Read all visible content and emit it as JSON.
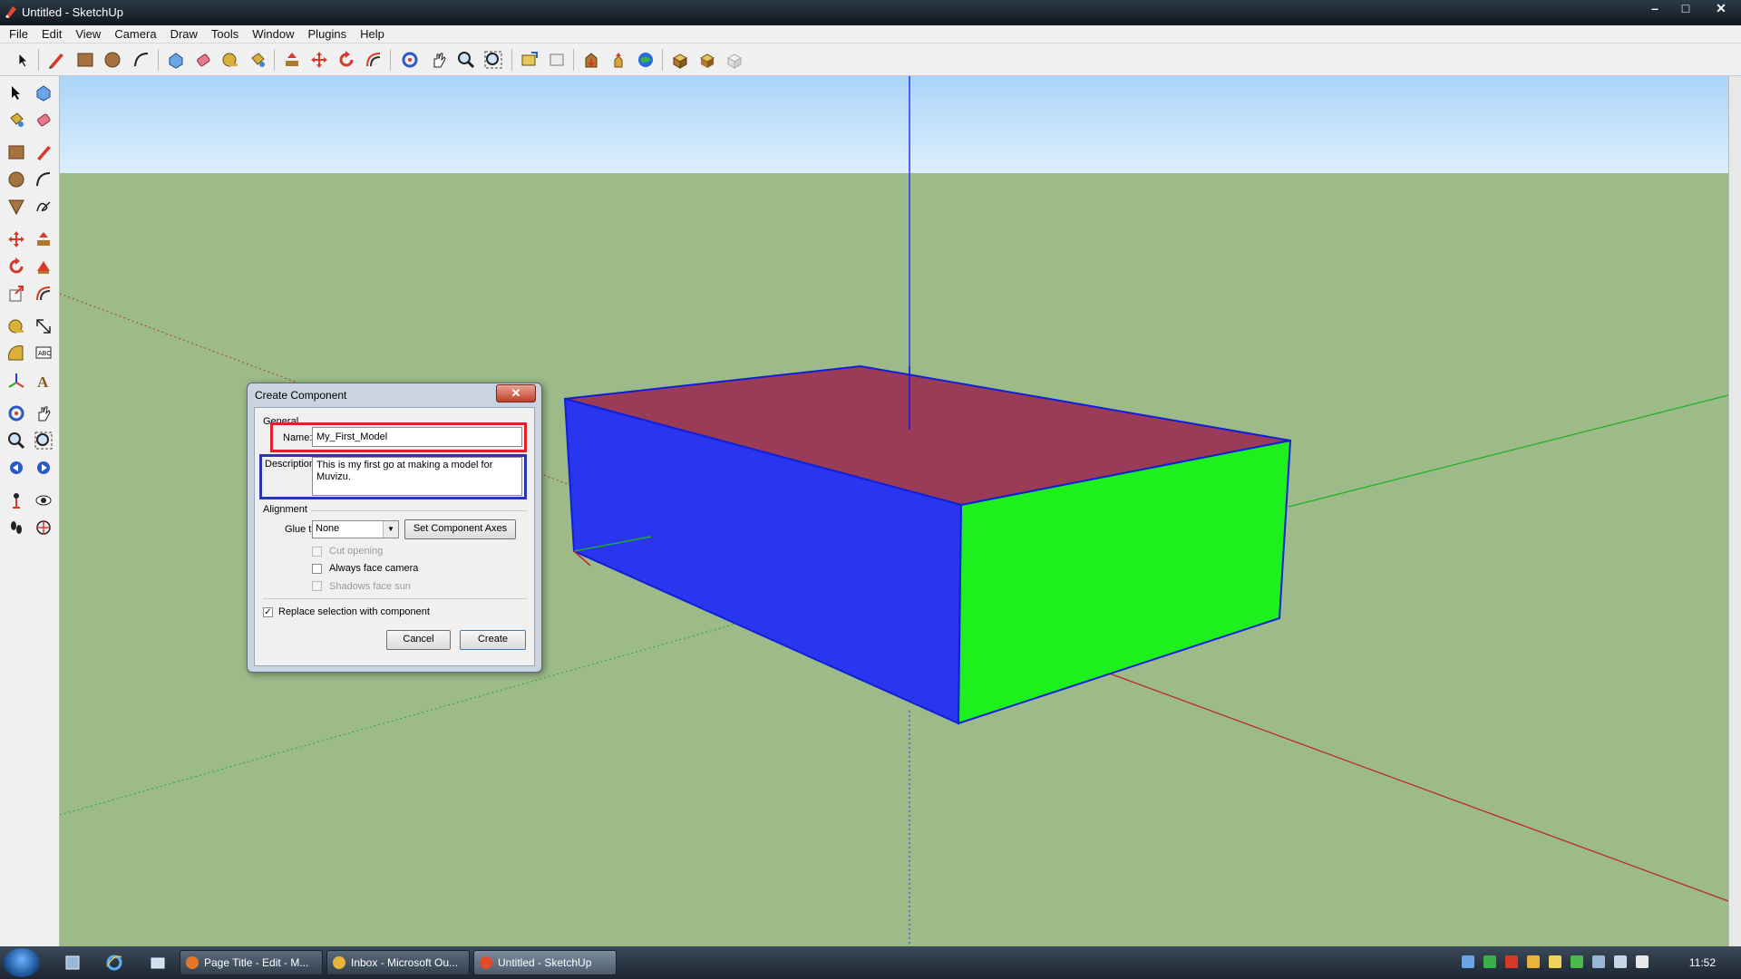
{
  "window": {
    "title": "Untitled - SketchUp"
  },
  "menu": [
    "File",
    "Edit",
    "View",
    "Camera",
    "Draw",
    "Tools",
    "Window",
    "Plugins",
    "Help"
  ],
  "dialog": {
    "title": "Create Component",
    "close_label": "✕",
    "general_label": "General",
    "name_label": "Name:",
    "name_value": "My_First_Model",
    "description_label": "Description:",
    "description_value": "This is my first go at making a model for Muvizu.",
    "alignment_label": "Alignment",
    "glue_label": "Glue to:",
    "glue_value": "None",
    "set_axes_label": "Set Component Axes",
    "cut_opening_label": "Cut opening",
    "always_face_camera_label": "Always face camera",
    "shadows_face_sun_label": "Shadows face sun",
    "replace_selection_label": "Replace selection with component",
    "replace_selection_checked": "✓",
    "cancel_label": "Cancel",
    "create_label": "Create"
  },
  "taskbar": {
    "tasks": [
      {
        "label": "Page Title - Edit - M...",
        "active": false
      },
      {
        "label": "Inbox - Microsoft Ou...",
        "active": false
      },
      {
        "label": "Untitled - SketchUp",
        "active": true
      }
    ],
    "clock": "11:52"
  },
  "colors": {
    "ground": "#9cbb88",
    "box_top": "#9a3b57",
    "box_front": "#2a35f0",
    "box_right": "#1df01d",
    "box_edge": "#1020d8",
    "highlight_name": "#e0202a",
    "highlight_description": "#2a36b0"
  }
}
